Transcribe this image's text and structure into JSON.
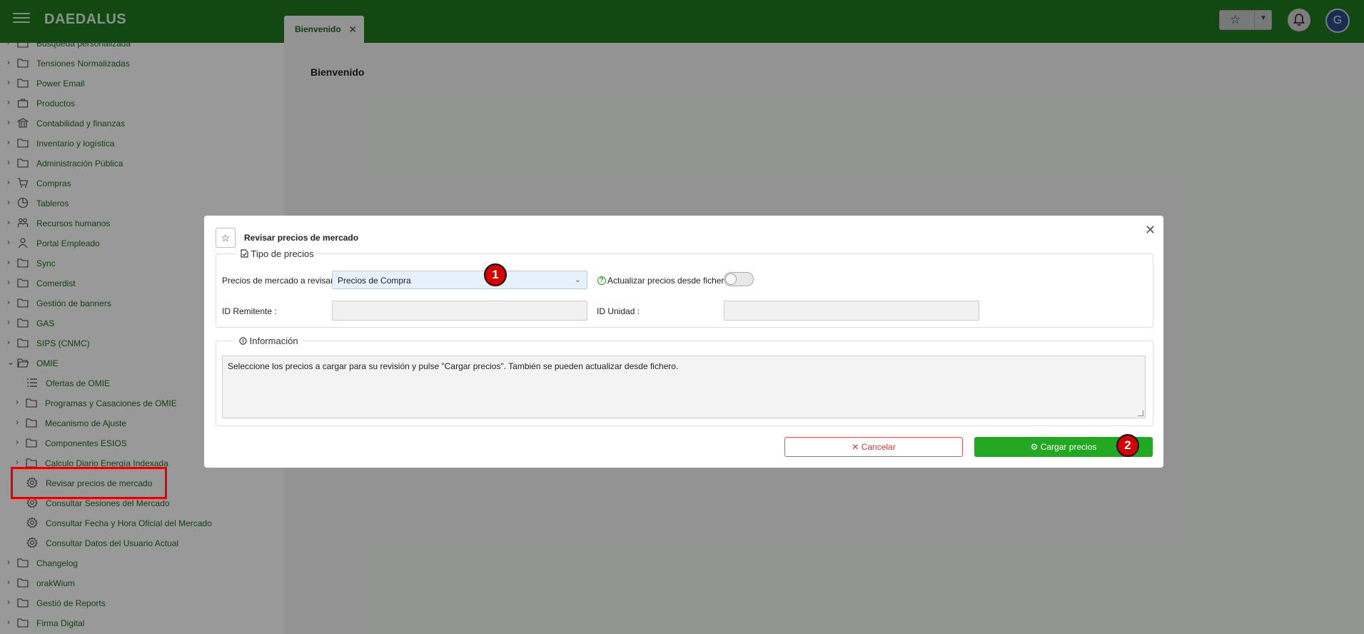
{
  "app": {
    "brand": "DAEDALUS",
    "avatar_initial": "G"
  },
  "tabs": [
    {
      "label": "Bienvenido",
      "close": "✕"
    }
  ],
  "content": {
    "title": "Bienvenido"
  },
  "sidebar": {
    "items": [
      {
        "label": "Búsqueda personalizada",
        "chevron": "›",
        "icon": "folder-icon"
      },
      {
        "label": "Tensiones Normalizadas",
        "chevron": "›",
        "icon": "folder-icon"
      },
      {
        "label": "Power Email",
        "chevron": "›",
        "icon": "folder-icon"
      },
      {
        "label": "Productos",
        "chevron": "›",
        "icon": "briefcase-icon"
      },
      {
        "label": "Contabilidad y finanzas",
        "chevron": "›",
        "icon": "bank-icon"
      },
      {
        "label": "Inventario y logística",
        "chevron": "›",
        "icon": "folder-icon"
      },
      {
        "label": "Administración Pública",
        "chevron": "›",
        "icon": "folder-icon"
      },
      {
        "label": "Compras",
        "chevron": "›",
        "icon": "cart-icon"
      },
      {
        "label": "Tableros",
        "chevron": "›",
        "icon": "pie-chart-icon"
      },
      {
        "label": "Recursos humanos",
        "chevron": "›",
        "icon": "people-icon"
      },
      {
        "label": "Portal Empleado",
        "chevron": "›",
        "icon": "person-icon"
      },
      {
        "label": "Sync",
        "chevron": "›",
        "icon": "folder-icon"
      },
      {
        "label": "Comerdist",
        "chevron": "›",
        "icon": "folder-icon"
      },
      {
        "label": "Gestión de banners",
        "chevron": "›",
        "icon": "folder-icon"
      },
      {
        "label": "GAS",
        "chevron": "›",
        "icon": "folder-icon"
      },
      {
        "label": "SIPS (CNMC)",
        "chevron": "›",
        "icon": "folder-icon"
      },
      {
        "label": "OMIE",
        "chevron": "⌄",
        "icon": "folder-open-icon"
      },
      {
        "label": "Ofertas de OMIE",
        "chevron": "",
        "icon": "list-icon"
      },
      {
        "label": "Programas y Casaciones de OMIE",
        "chevron": "›",
        "icon": "folder-icon"
      },
      {
        "label": "Mecanismo de Ajuste",
        "chevron": "›",
        "icon": "folder-icon"
      },
      {
        "label": "Componentes ESIOS",
        "chevron": "›",
        "icon": "folder-icon"
      },
      {
        "label": "Calculo Diario Energía Indexada",
        "chevron": "›",
        "icon": "folder-icon"
      },
      {
        "label": "Revisar precios de mercado",
        "chevron": "",
        "icon": "gear-icon"
      },
      {
        "label": "Consultar Sesiones del Mercado",
        "chevron": "",
        "icon": "gear-icon"
      },
      {
        "label": "Consultar Fecha y Hora Oficial del Mercado",
        "chevron": "",
        "icon": "gear-icon"
      },
      {
        "label": "Consultar Datos del Usuario Actual",
        "chevron": "",
        "icon": "gear-icon"
      },
      {
        "label": "Changelog",
        "chevron": "›",
        "icon": "folder-icon"
      },
      {
        "label": "orakWium",
        "chevron": "›",
        "icon": "folder-icon"
      },
      {
        "label": "Gestió de Reports",
        "chevron": "›",
        "icon": "folder-icon"
      },
      {
        "label": "Firma Digital",
        "chevron": "›",
        "icon": "folder-icon"
      }
    ]
  },
  "modal": {
    "title": "Revisar precios de mercado",
    "star": "☆",
    "close": "✕",
    "section1": {
      "legend": "Tipo de precios",
      "precios_label": "Precios de mercado a revisar :",
      "precios_value": "Precios de Compra",
      "actualizar_label": "Actualizar precios desde fichero :",
      "actualizar_on": false,
      "remitente_label": "ID Remitente :",
      "remitente_value": "",
      "unidad_label": "ID Unidad :",
      "unidad_value": ""
    },
    "section2": {
      "legend": "Información",
      "text": "Seleccione los precios a cargar para su revisión y pulse \"Cargar precios\". También se pueden actualizar desde fichero."
    },
    "cancel_label": "Cancelar",
    "load_label": "Cargar precios"
  },
  "annotations": {
    "badge1": "1",
    "badge2": "2",
    "highlight_color": "#e10000"
  },
  "colors": {
    "brand": "#1e7a1e",
    "primary_button": "#22a822",
    "danger": "#d23b3b"
  }
}
